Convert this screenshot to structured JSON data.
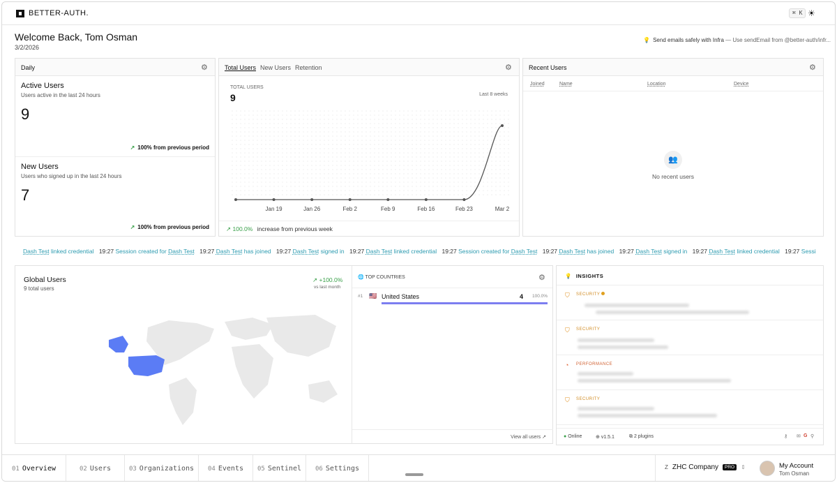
{
  "app": {
    "brand": "BETTER-AUTH.",
    "shortcut": "⌘ K"
  },
  "header": {
    "welcome": "Welcome Back, Tom Osman",
    "date": "3/2/2026",
    "tip_title": "Send emails safely with Infra",
    "tip_rest": "— Use sendEmail from @better-auth/infr..."
  },
  "daily": {
    "title": "Daily",
    "active": {
      "title": "Active Users",
      "sub": "Users active in the last 24 hours",
      "value": "9",
      "trend": "100% from previous period"
    },
    "new": {
      "title": "New Users",
      "sub": "Users who signed up in the last 24 hours",
      "value": "7",
      "trend": "100% from previous period"
    }
  },
  "growth": {
    "tabs": [
      "Total Users",
      "New Users",
      "Retention"
    ],
    "label": "TOTAL USERS",
    "value": "9",
    "range": "Last 8 weeks",
    "footer_pct": "100.0%",
    "footer_text": "increase from previous week"
  },
  "chart_data": {
    "type": "line",
    "x": [
      "",
      "Jan 19",
      "Jan 26",
      "Feb 2",
      "Feb 9",
      "Feb 16",
      "Feb 23",
      "Mar 2"
    ],
    "values": [
      0,
      0,
      0,
      0,
      0,
      0,
      0,
      9
    ],
    "title": "TOTAL USERS",
    "xlabel": "",
    "ylabel": "",
    "grid": true
  },
  "recent": {
    "title": "Recent Users",
    "columns": [
      "Joined",
      "Name",
      "Location",
      "Device"
    ],
    "empty": "No recent users"
  },
  "ticker": [
    {
      "time": "",
      "actor": "Dash Test",
      "text": "linked credential"
    },
    {
      "time": "19:27",
      "actor": "",
      "text": "Session created for",
      "target": "Dash Test"
    },
    {
      "time": "19:27",
      "actor": "Dash Test",
      "text": "has joined"
    },
    {
      "time": "19:27",
      "actor": "Dash Test",
      "text": "signed in"
    },
    {
      "time": "19:27",
      "actor": "Dash Test",
      "text": "linked credential"
    },
    {
      "time": "19:27",
      "actor": "",
      "text": "Session created for",
      "target": "Dash Test"
    },
    {
      "time": "19:27",
      "actor": "Dash Test",
      "text": "has joined"
    },
    {
      "time": "19:27",
      "actor": "Dash Test",
      "text": "signed in"
    },
    {
      "time": "19:27",
      "actor": "Dash Test",
      "text": "linked credential"
    },
    {
      "time": "19:27",
      "actor": "",
      "text": "Sessi"
    }
  ],
  "global": {
    "title": "Global Users",
    "sub": "9 total users",
    "change": "+100.0%",
    "change_sub": "vs last month",
    "highlight_color": "#5b7cf5"
  },
  "countries": {
    "title": "TOP COUNTRIES",
    "rank": "#1",
    "flag": "🇺🇸",
    "name": "United States",
    "count": "4",
    "pct": "100.0%",
    "share": 1.0,
    "view_all": "View all users ↗"
  },
  "insights": {
    "title": "INSIGHTS",
    "items": [
      {
        "tag": "SECURITY"
      },
      {
        "tag": "SECURITY"
      },
      {
        "tag": "PERFORMANCE"
      },
      {
        "tag": "SECURITY"
      }
    ],
    "status": "Online",
    "version": "v1.5.1",
    "plugins": "2 plugins"
  },
  "nav": {
    "tabs": [
      {
        "num": "01",
        "label": "Overview"
      },
      {
        "num": "02",
        "label": "Users"
      },
      {
        "num": "03",
        "label": "Organizations"
      },
      {
        "num": "04",
        "label": "Events"
      },
      {
        "num": "05",
        "label": "Sentinel"
      },
      {
        "num": "06",
        "label": "Settings"
      }
    ],
    "org_initial": "Z",
    "org": "ZHC Company",
    "plan": "PRO",
    "account": "My Account",
    "user": "Tom Osman"
  }
}
